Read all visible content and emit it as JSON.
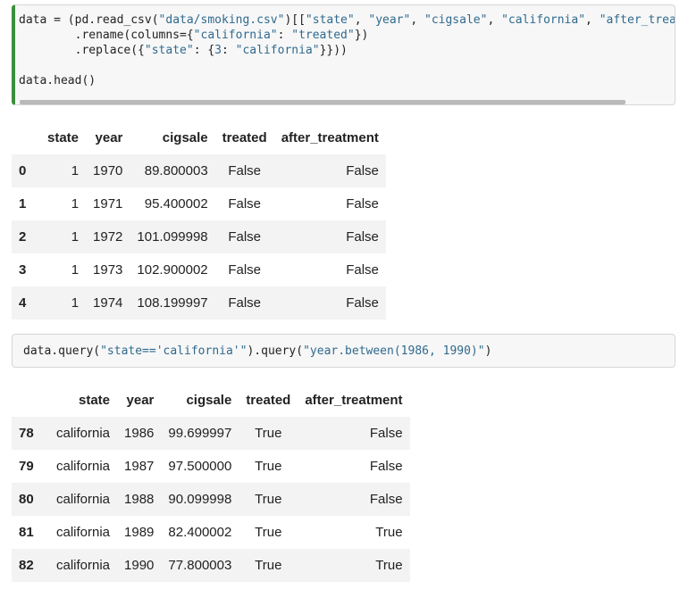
{
  "cell1": {
    "code_lines": [
      [
        {
          "t": "data = (pd.read_csv(",
          "c": ""
        },
        {
          "t": "\"data/smoking.csv\"",
          "c": "s"
        },
        {
          "t": ")[[",
          "c": ""
        },
        {
          "t": "\"state\"",
          "c": "s"
        },
        {
          "t": ", ",
          "c": ""
        },
        {
          "t": "\"year\"",
          "c": "s"
        },
        {
          "t": ", ",
          "c": ""
        },
        {
          "t": "\"cigsale\"",
          "c": "s"
        },
        {
          "t": ", ",
          "c": ""
        },
        {
          "t": "\"california\"",
          "c": "s"
        },
        {
          "t": ", ",
          "c": ""
        },
        {
          "t": "\"after_treatm",
          "c": "s"
        }
      ],
      [
        {
          "t": "        .rename(columns={",
          "c": ""
        },
        {
          "t": "\"california\"",
          "c": "s"
        },
        {
          "t": ": ",
          "c": ""
        },
        {
          "t": "\"treated\"",
          "c": "s"
        },
        {
          "t": "})",
          "c": ""
        }
      ],
      [
        {
          "t": "        .replace({",
          "c": ""
        },
        {
          "t": "\"state\"",
          "c": "s"
        },
        {
          "t": ": {",
          "c": ""
        },
        {
          "t": "3",
          "c": "n"
        },
        {
          "t": ": ",
          "c": ""
        },
        {
          "t": "\"california\"",
          "c": "s"
        },
        {
          "t": "}}))",
          "c": ""
        }
      ],
      [],
      [
        {
          "t": "data.head()",
          "c": ""
        }
      ]
    ]
  },
  "table1": {
    "columns": [
      "state",
      "year",
      "cigsale",
      "treated",
      "after_treatment"
    ],
    "rows": [
      {
        "index": "0",
        "state": "1",
        "year": "1970",
        "cigsale": "89.800003",
        "treated": "False",
        "after_treatment": "False"
      },
      {
        "index": "1",
        "state": "1",
        "year": "1971",
        "cigsale": "95.400002",
        "treated": "False",
        "after_treatment": "False"
      },
      {
        "index": "2",
        "state": "1",
        "year": "1972",
        "cigsale": "101.099998",
        "treated": "False",
        "after_treatment": "False"
      },
      {
        "index": "3",
        "state": "1",
        "year": "1973",
        "cigsale": "102.900002",
        "treated": "False",
        "after_treatment": "False"
      },
      {
        "index": "4",
        "state": "1",
        "year": "1974",
        "cigsale": "108.199997",
        "treated": "False",
        "after_treatment": "False"
      }
    ]
  },
  "cell2": {
    "code_lines": [
      [
        {
          "t": "data.query(",
          "c": ""
        },
        {
          "t": "\"state=='california'\"",
          "c": "s"
        },
        {
          "t": ").query(",
          "c": ""
        },
        {
          "t": "\"year.between(1986, 1990)\"",
          "c": "s"
        },
        {
          "t": ")",
          "c": ""
        }
      ]
    ]
  },
  "table2": {
    "columns": [
      "state",
      "year",
      "cigsale",
      "treated",
      "after_treatment"
    ],
    "rows": [
      {
        "index": "78",
        "state": "california",
        "year": "1986",
        "cigsale": "99.699997",
        "treated": "True",
        "after_treatment": "False"
      },
      {
        "index": "79",
        "state": "california",
        "year": "1987",
        "cigsale": "97.500000",
        "treated": "True",
        "after_treatment": "False"
      },
      {
        "index": "80",
        "state": "california",
        "year": "1988",
        "cigsale": "90.099998",
        "treated": "True",
        "after_treatment": "False"
      },
      {
        "index": "81",
        "state": "california",
        "year": "1989",
        "cigsale": "82.400002",
        "treated": "True",
        "after_treatment": "True"
      },
      {
        "index": "82",
        "state": "california",
        "year": "1990",
        "cigsale": "77.800003",
        "treated": "True",
        "after_treatment": "True"
      }
    ]
  }
}
